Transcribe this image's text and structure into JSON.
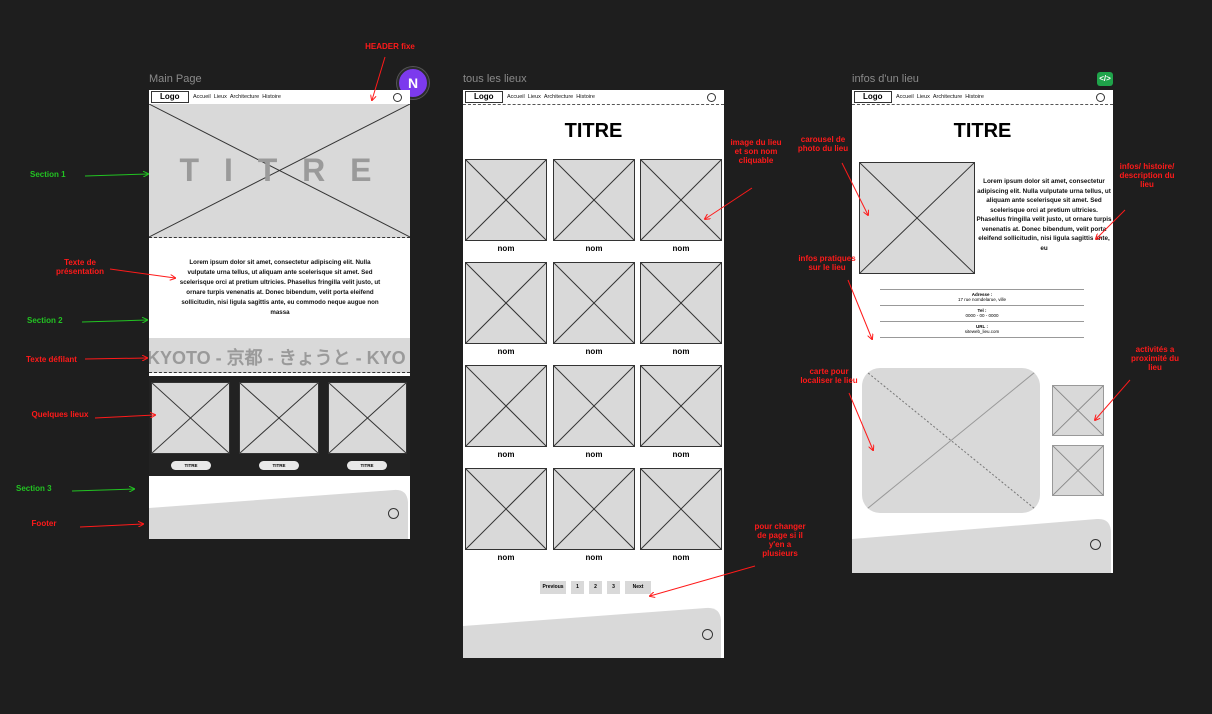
{
  "frames": {
    "main": "Main Page",
    "all": "tous les lieux",
    "info": "infos d'un lieu"
  },
  "nav": {
    "logo": "Logo",
    "links": [
      "Accueil",
      "Lieux",
      "Architecture",
      "Histoire"
    ]
  },
  "main_page": {
    "hero_title": "T I T R E",
    "presentation_text": "Lorem ipsum dolor sit amet, consectetur adipiscing elit. Nulla vulputate urna tellus, ut aliquam ante scelerisque sit amet. Sed scelerisque orci at pretium ultricies. Phasellus fringilla velit justo, ut ornare turpis venenatis at. Donec bibendum, velit porta eleifend sollicitudin, nisi ligula sagittis ante, eu commodo neque augue non massa",
    "scrolling_text": "KYOTO - 京都 - きょうと - KYO",
    "place_titles": [
      "TITRE",
      "TITRE",
      "TITRE"
    ]
  },
  "all_places": {
    "title": "TITRE",
    "place_names": [
      "nom",
      "nom",
      "nom",
      "nom",
      "nom",
      "nom",
      "nom",
      "nom",
      "nom",
      "nom",
      "nom",
      "nom"
    ],
    "pagination": [
      "Previous",
      "1",
      "2",
      "3",
      "Next"
    ]
  },
  "place_info": {
    "title": "TITRE",
    "description": "Lorem ipsum dolor sit amet, consectetur adipiscing elit. Nulla vulputate urna tellus, ut aliquam ante scelerisque sit amet. Sed scelerisque orci at pretium ultricies. Phasellus fringilla velit justo, ut ornare turpis venenatis at. Donec bibendum, velit porta eleifend sollicitudin, nisi ligula sagittis ante, eu",
    "address_label": "Adresse :",
    "address_value": "17 rue nomdelarue, ville",
    "tel_label": "Tel :",
    "tel_value": "0000 - 00 - 0000",
    "url_label": "URL :",
    "url_value": "siteweb_lieu.com"
  },
  "annotations": {
    "header_fixe": "HEADER fixe",
    "section1": "Section 1",
    "texte_presentation": "Texte de présentation",
    "section2": "Section 2",
    "texte_defilant": "Texte défilant",
    "quelques_lieux": "Quelques lieux",
    "section3": "Section 3",
    "footer": "Footer",
    "image_lieu": "image du lieu et son nom cliquable",
    "pagination": "pour changer de page si il y'en a plusieurs",
    "carousel": "carousel de photo du lieu",
    "infos_histoire": "infos/ histoire/ description du lieu",
    "infos_pratiques": "infos pratiques sur le lieu",
    "carte": "carte pour localiser le lieu",
    "activites": "activités a proximité du lieu"
  },
  "collaborator_avatar": "N",
  "colors": {
    "canvas": "#1e1e1e",
    "annotation_red": "#ff1a1a",
    "annotation_green": "#22c322",
    "avatar": "#7c3aed",
    "plugin": "#1fa34a"
  }
}
